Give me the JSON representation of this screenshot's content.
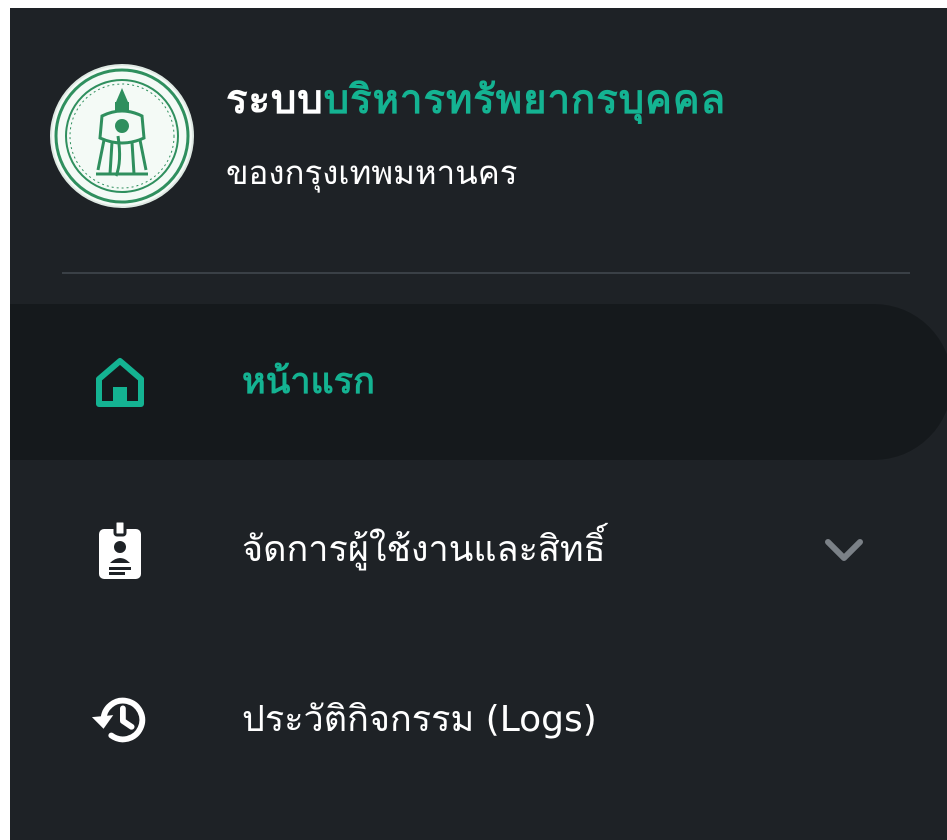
{
  "brand": {
    "title_part1": "ระบบ",
    "title_part2": "บริหารทรัพยากรบุคคล",
    "subtitle": "ของกรุงเทพมหานคร",
    "logo_icon": "bangkok-seal-icon"
  },
  "nav": {
    "items": [
      {
        "label": "หน้าแรก",
        "icon": "home-icon",
        "active": true
      },
      {
        "label": "จัดการผู้ใช้งานและสิทธิ์",
        "icon": "id-badge-icon",
        "active": false,
        "expandable": true
      },
      {
        "label": "ประวัติกิจกรรม (Logs)",
        "icon": "history-icon",
        "active": false
      }
    ]
  },
  "colors": {
    "sidebar_bg": "#1e2226",
    "active_bg": "#15191c",
    "accent": "#14b392",
    "text": "#ffffff",
    "chevron": "#7b8187"
  }
}
